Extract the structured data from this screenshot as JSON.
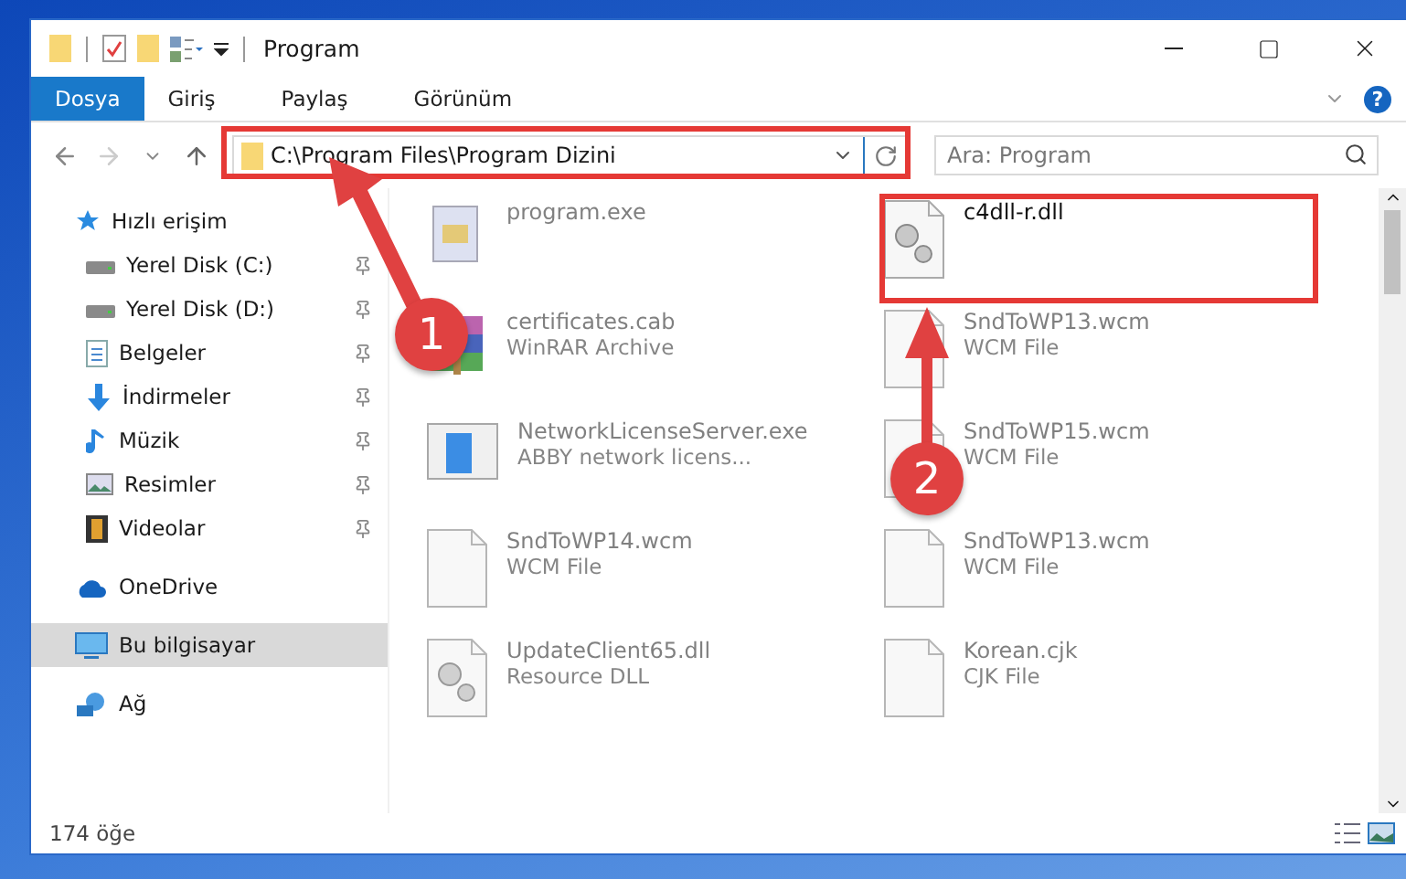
{
  "window": {
    "title": "Program"
  },
  "ribbon": {
    "tabs": [
      {
        "label": "Dosya",
        "selected": true
      },
      {
        "label": "Giriş",
        "selected": false
      },
      {
        "label": "Paylaş",
        "selected": false
      },
      {
        "label": "Görünüm",
        "selected": false
      }
    ],
    "help": "?"
  },
  "address": {
    "path": "C:\\Program Files\\Program Dizini"
  },
  "search": {
    "placeholder": "Ara: Program"
  },
  "sidebar": {
    "items": [
      {
        "label": "Hızlı erişim",
        "kind": "quick",
        "selected": false,
        "children": [
          {
            "label": "Yerel Disk (C:)",
            "kind": "drive",
            "pinned": true
          },
          {
            "label": "Yerel Disk (D:)",
            "kind": "drive",
            "pinned": true
          },
          {
            "label": "Belgeler",
            "kind": "docs",
            "pinned": true
          },
          {
            "label": "İndirmeler",
            "kind": "download",
            "pinned": true
          },
          {
            "label": "Müzik",
            "kind": "music",
            "pinned": true
          },
          {
            "label": "Resimler",
            "kind": "pictures",
            "pinned": true
          },
          {
            "label": "Videolar",
            "kind": "videos",
            "pinned": true
          }
        ]
      },
      {
        "label": "OneDrive",
        "kind": "cloud",
        "selected": false
      },
      {
        "label": "Bu bilgisayar",
        "kind": "pc",
        "selected": true
      },
      {
        "label": "Ağ",
        "kind": "network",
        "selected": false
      }
    ]
  },
  "files": [
    {
      "name": "program.exe",
      "kind": "exe",
      "focus": false
    },
    {
      "name": "c4dll-r.dll",
      "kind": "dll",
      "focus": true
    },
    {
      "name": "certificates.cab",
      "type": "WinRAR Archive",
      "kind": "archive",
      "focus": false
    },
    {
      "name": "SndToWP13.wcm",
      "type": "WCM File",
      "kind": "doc",
      "focus": false
    },
    {
      "name": "NetworkLicenseServer.exe",
      "type": "ABBY network licens...",
      "kind": "app",
      "focus": false
    },
    {
      "name": "SndToWP15.wcm",
      "type": "WCM File",
      "kind": "doc",
      "focus": false
    },
    {
      "name": "SndToWP14.wcm",
      "type": "WCM File",
      "kind": "doc",
      "focus": false
    },
    {
      "name": "SndToWP13.wcm",
      "type": "WCM File",
      "kind": "doc",
      "focus": false
    },
    {
      "name": "UpdateClient65.dll",
      "type": "Resource DLL",
      "kind": "dll",
      "focus": false
    },
    {
      "name": "Korean.cjk",
      "type": "CJK File",
      "kind": "doc",
      "focus": false
    }
  ],
  "status_bar": {
    "count": "174 öğe"
  },
  "callouts": [
    {
      "number": "1"
    },
    {
      "number": "2"
    }
  ]
}
